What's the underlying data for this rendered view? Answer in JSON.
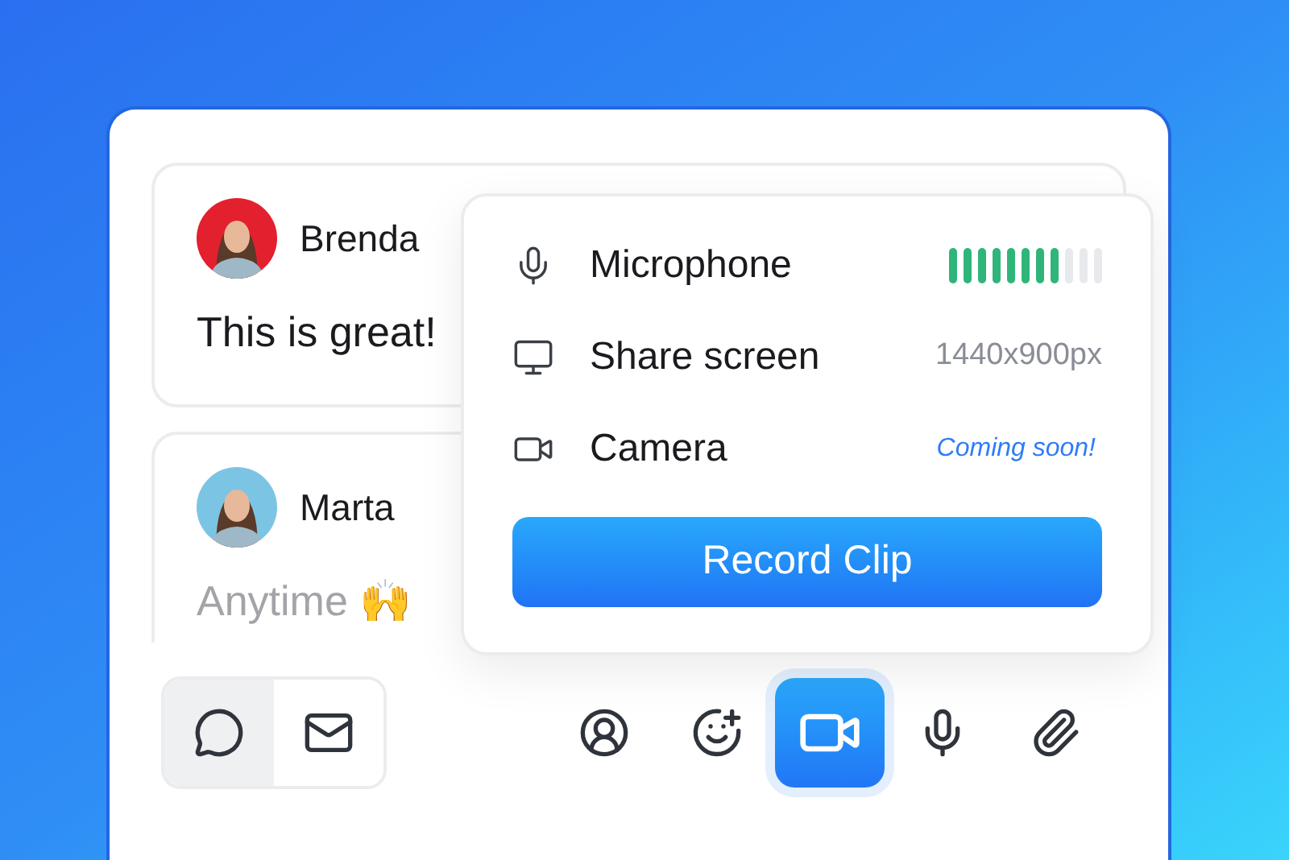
{
  "messages": [
    {
      "name": "Brenda",
      "text": "This is great!",
      "faded": false,
      "color": "#e3202e"
    },
    {
      "name": "Marta",
      "text": "Anytime 🙌",
      "faded": true,
      "color": "#7cc4e4"
    }
  ],
  "recording_menu": {
    "rows": [
      {
        "kind": "meter",
        "label": "Microphone",
        "level": 0.73
      },
      {
        "kind": "value",
        "label": "Share screen",
        "value": "1440x900px"
      },
      {
        "kind": "note",
        "label": "Camera",
        "value": "Coming soon!"
      }
    ],
    "button": "Record Clip"
  },
  "toolbar": {
    "modes": [
      {
        "selected": true
      },
      {
        "selected": false
      }
    ],
    "actions": [
      {
        "selected": false
      },
      {
        "selected": false
      },
      {
        "selected": true
      },
      {
        "selected": false
      },
      {
        "selected": false
      }
    ]
  }
}
